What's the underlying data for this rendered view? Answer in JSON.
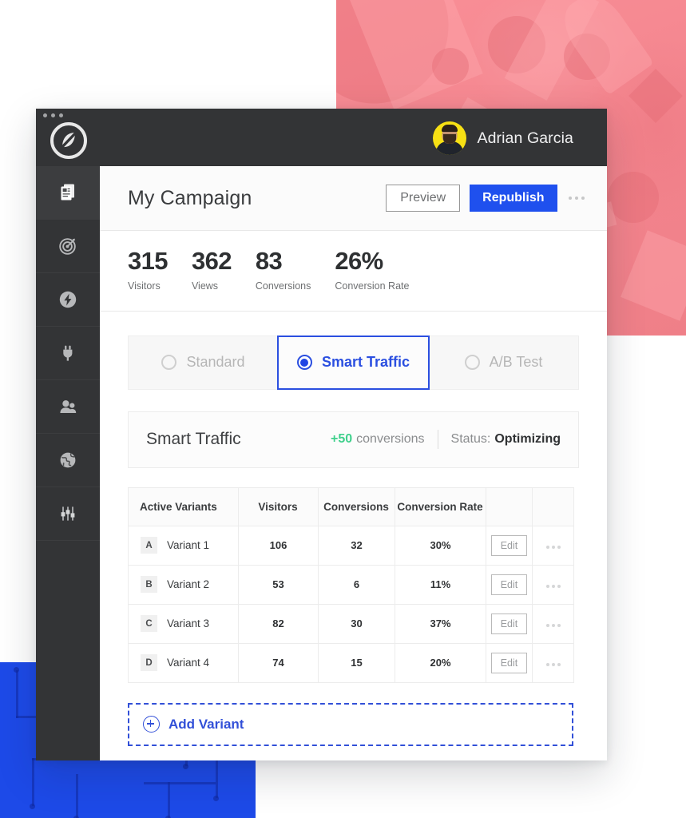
{
  "window": {
    "brand_icon": "unbounce-logo-icon",
    "traffic_dots": "window-controls"
  },
  "header": {
    "user_name": "Adrian Garcia",
    "avatar": "user-avatar-photo"
  },
  "sidebar": {
    "items": [
      {
        "icon": "pages-icon",
        "name": "pages",
        "active": true
      },
      {
        "icon": "target-icon",
        "name": "goals",
        "active": false
      },
      {
        "icon": "lightning-icon",
        "name": "scripts",
        "active": false
      },
      {
        "icon": "plug-icon",
        "name": "integrations",
        "active": false
      },
      {
        "icon": "people-icon",
        "name": "leads",
        "active": false
      },
      {
        "icon": "globe-icon",
        "name": "domains",
        "active": false
      },
      {
        "icon": "sliders-icon",
        "name": "settings",
        "active": false
      }
    ]
  },
  "page": {
    "title": "My Campaign",
    "preview_label": "Preview",
    "republish_label": "Republish",
    "more_menu": "more-options"
  },
  "stats": [
    {
      "value": "315",
      "label": "Visitors"
    },
    {
      "value": "362",
      "label": "Views"
    },
    {
      "value": "83",
      "label": "Conversions"
    },
    {
      "value": "26%",
      "label": "Conversion Rate"
    }
  ],
  "modes": [
    {
      "label": "Standard",
      "selected": false
    },
    {
      "label": "Smart Traffic",
      "selected": true
    },
    {
      "label": "A/B Test",
      "selected": false
    }
  ],
  "smart_traffic": {
    "title": "Smart Traffic",
    "conversion_delta": "+50",
    "conversion_word": "conversions",
    "status_label": "Status:",
    "status_value": "Optimizing"
  },
  "table": {
    "headers": [
      "Active Variants",
      "Visitors",
      "Conversions",
      "Conversion Rate",
      "",
      ""
    ],
    "rows": [
      {
        "badge": "A",
        "name": "Variant 1",
        "visitors": "106",
        "conversions": "32",
        "rate": "30%",
        "edit": "Edit"
      },
      {
        "badge": "B",
        "name": "Variant 2",
        "visitors": "53",
        "conversions": "6",
        "rate": "11%",
        "edit": "Edit"
      },
      {
        "badge": "C",
        "name": "Variant 3",
        "visitors": "82",
        "conversions": "30",
        "rate": "37%",
        "edit": "Edit"
      },
      {
        "badge": "D",
        "name": "Variant 4",
        "visitors": "74",
        "conversions": "15",
        "rate": "20%",
        "edit": "Edit"
      }
    ]
  },
  "add_variant": {
    "label": "Add Variant",
    "icon": "plus-circle-icon"
  },
  "colors": {
    "accent_blue": "#1f50ee",
    "selected_blue": "#2b4fe0",
    "dashed_blue": "#3250d8",
    "success_green": "#3fd08c",
    "chrome_dark": "#333436",
    "rail_active": "#3c3d3f",
    "avatar_yellow": "#f7e014",
    "bg_pink": "#f4868f",
    "bg_blue": "#1d4ae8"
  }
}
